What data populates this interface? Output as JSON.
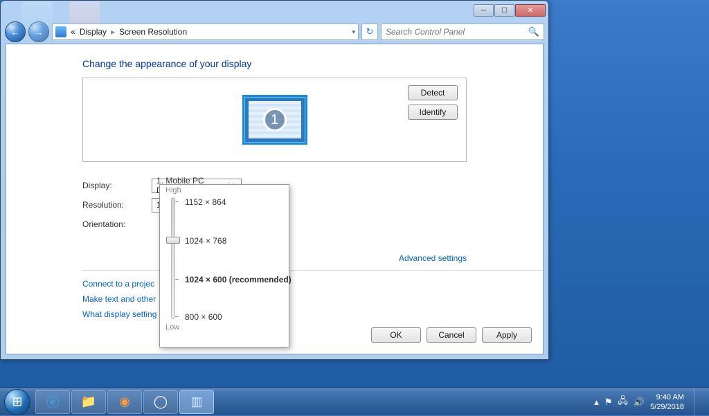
{
  "breadcrumb": {
    "part1": "Display",
    "part2": "Screen Resolution",
    "prefix": "«"
  },
  "search": {
    "placeholder": "Search Control Panel"
  },
  "heading": "Change the appearance of your display",
  "preview": {
    "monitor_number": "1",
    "detect": "Detect",
    "identify": "Identify"
  },
  "labels": {
    "display": "Display:",
    "resolution": "Resolution:",
    "orientation": "Orientation:"
  },
  "combos": {
    "display": "1. Mobile PC Display",
    "resolution": "1024 × 768"
  },
  "links": {
    "advanced": "Advanced settings",
    "projector": "Connect to a projec",
    "textsize": "Make text and other",
    "whatsettings": "What display setting"
  },
  "buttons": {
    "ok": "OK",
    "cancel": "Cancel",
    "apply": "Apply"
  },
  "res_slider": {
    "high": "High",
    "low": "Low",
    "options": [
      "1152 × 864",
      "1024 × 768",
      "1024 × 600 (recommended)",
      "800 × 600"
    ],
    "selected_index": 1
  },
  "tray": {
    "time": "9:40 AM",
    "date": "5/29/2018"
  }
}
